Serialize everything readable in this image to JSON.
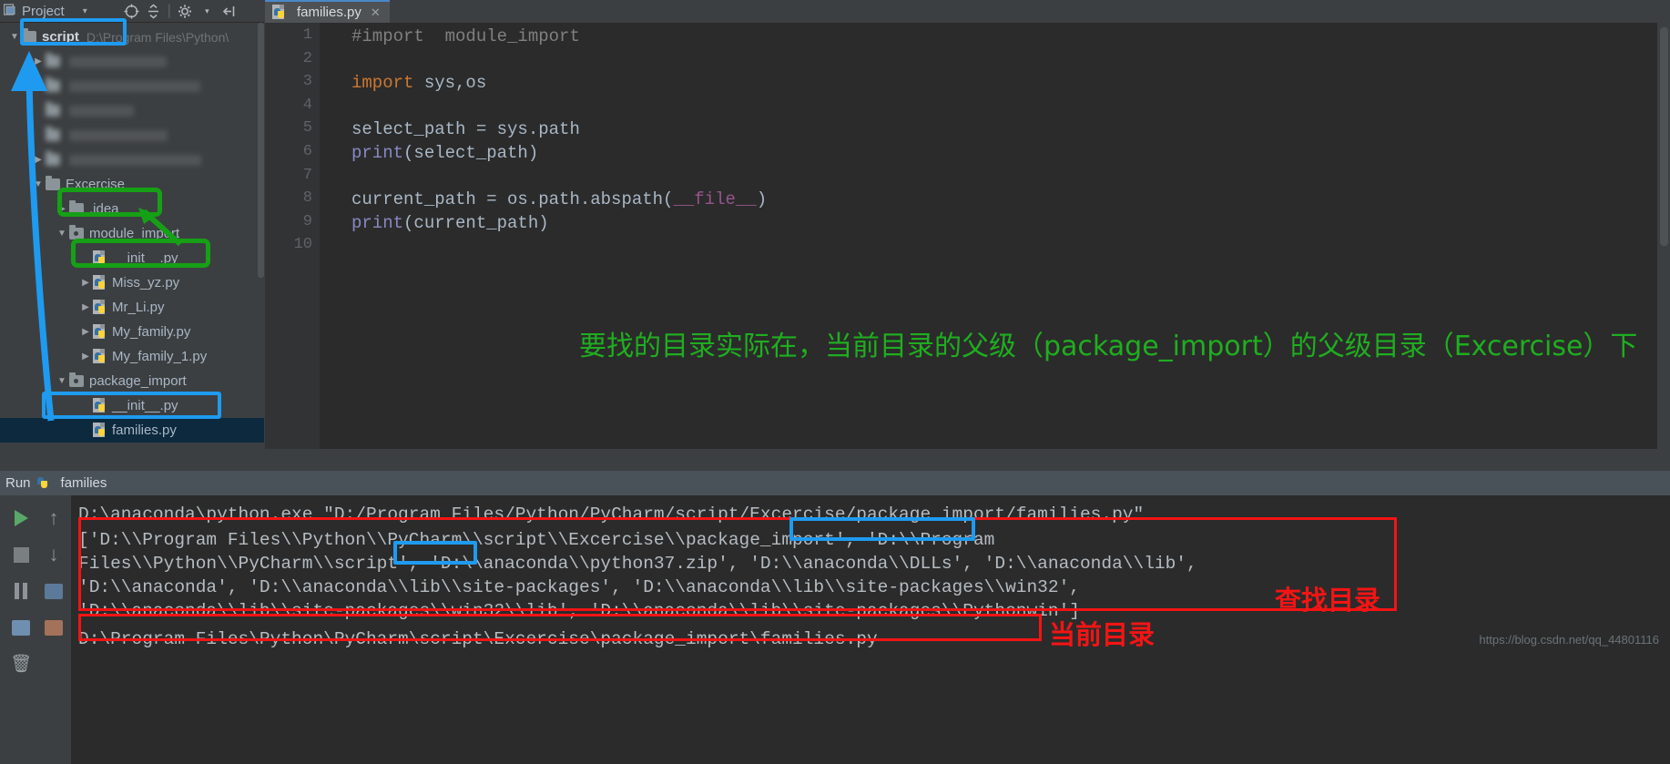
{
  "project": {
    "header": {
      "title": "Project",
      "icon": "project-icon",
      "chevron": "▾",
      "tools": [
        "target-icon",
        "collapse-all-icon",
        "settings-icon",
        "hide-icon"
      ]
    },
    "tree": [
      {
        "id": "script",
        "label": "script",
        "path": "D:\\Program Files\\Python\\",
        "indent": 0,
        "arrow": "▼",
        "type": "folder",
        "bold": true
      },
      {
        "id": "blur1",
        "label": "",
        "indent": 1,
        "arrow": "▶",
        "type": "blur"
      },
      {
        "id": "blur2",
        "label": "",
        "indent": 1,
        "arrow": "▶",
        "type": "blur"
      },
      {
        "id": "blur3",
        "label": "",
        "indent": 1,
        "arrow": "",
        "type": "blur"
      },
      {
        "id": "blur4",
        "label": "",
        "indent": 1,
        "arrow": "",
        "type": "blur"
      },
      {
        "id": "blur5",
        "label": "",
        "indent": 1,
        "arrow": "▶",
        "type": "blur"
      },
      {
        "id": "excercise",
        "label": "Excercise",
        "indent": 1,
        "arrow": "▼",
        "type": "folder"
      },
      {
        "id": "idea",
        "label": ".idea",
        "indent": 2,
        "arrow": "▶",
        "type": "folder"
      },
      {
        "id": "module_import",
        "label": "module_import",
        "indent": 2,
        "arrow": "▼",
        "type": "source-folder"
      },
      {
        "id": "init1",
        "label": "__init__.py",
        "indent": 3,
        "arrow": "",
        "type": "py"
      },
      {
        "id": "miss_yz",
        "label": "Miss_yz.py",
        "indent": 3,
        "arrow": "▶",
        "type": "py"
      },
      {
        "id": "mr_li",
        "label": "Mr_Li.py",
        "indent": 3,
        "arrow": "▶",
        "type": "py"
      },
      {
        "id": "my_family",
        "label": "My_family.py",
        "indent": 3,
        "arrow": "▶",
        "type": "py"
      },
      {
        "id": "my_family_1",
        "label": "My_family_1.py",
        "indent": 3,
        "arrow": "▶",
        "type": "py"
      },
      {
        "id": "package_import",
        "label": "package_import",
        "indent": 2,
        "arrow": "▼",
        "type": "source-folder"
      },
      {
        "id": "init2",
        "label": "__init__.py",
        "indent": 3,
        "arrow": "",
        "type": "py"
      },
      {
        "id": "families",
        "label": "families.py",
        "indent": 3,
        "arrow": "",
        "type": "py",
        "selected": true
      }
    ]
  },
  "editor": {
    "tab": {
      "label": "families.py",
      "icon": "python-file-icon",
      "close": "✕"
    },
    "line_numbers": [
      "1",
      "2",
      "3",
      "4",
      "5",
      "6",
      "7",
      "8",
      "9",
      "10"
    ],
    "code": [
      {
        "n": 1,
        "tokens": [
          {
            "t": "#import  module_import",
            "c": "c-comment"
          }
        ]
      },
      {
        "n": 2,
        "tokens": []
      },
      {
        "n": 3,
        "tokens": [
          {
            "t": "import",
            "c": "c-kw"
          },
          {
            "t": " sys,os",
            "c": "c-plain"
          }
        ]
      },
      {
        "n": 4,
        "tokens": []
      },
      {
        "n": 5,
        "tokens": [
          {
            "t": "select_path = sys.path",
            "c": "c-plain"
          }
        ]
      },
      {
        "n": 6,
        "tokens": [
          {
            "t": "print",
            "c": "c-fn"
          },
          {
            "t": "(select_path)",
            "c": "c-plain"
          }
        ]
      },
      {
        "n": 7,
        "tokens": []
      },
      {
        "n": 8,
        "tokens": [
          {
            "t": "current_path = os.path.abspath(",
            "c": "c-plain"
          },
          {
            "t": "__file__",
            "c": "c-magic"
          },
          {
            "t": ")",
            "c": "c-plain"
          }
        ]
      },
      {
        "n": 9,
        "tokens": [
          {
            "t": "print",
            "c": "c-fn"
          },
          {
            "t": "(current_path)",
            "c": "c-plain"
          }
        ]
      },
      {
        "n": 10,
        "tokens": []
      }
    ],
    "annotation_green": "要找的目录实际在，当前目录的父级（package_import）的父级目录（Excercise）下"
  },
  "run": {
    "header": {
      "label": "Run",
      "icon": "python-run-icon",
      "config": "families"
    },
    "toolbar": [
      "run-icon",
      "up-arrow-icon",
      "stop-icon",
      "down-arrow-icon",
      "pause-icon",
      "rerun-icon",
      "print-icon",
      "export-icon",
      "trash-icon"
    ],
    "console_lines": [
      "D:\\anaconda\\python.exe \"D:/Program Files/Python/PyCharm/script/Excercise/package_import/families.py\"",
      "['D:\\\\Program Files\\\\Python\\\\PyCharm\\\\script\\\\Excercise\\\\package_import', 'D:\\\\Program",
      "Files\\\\Python\\\\PyCharm\\\\script', 'D:\\\\anaconda\\\\python37.zip', 'D:\\\\anaconda\\\\DLLs', 'D:\\\\anaconda\\\\lib',",
      "'D:\\\\anaconda', 'D:\\\\anaconda\\\\lib\\\\site-packages', 'D:\\\\anaconda\\\\lib\\\\site-packages\\\\win32',",
      "'D:\\\\anaconda\\\\lib\\\\site-packages\\\\win32\\\\lib', 'D:\\\\anaconda\\\\lib\\\\site-packages\\\\Pythonwin']",
      "D:\\Program Files\\Python\\PyCharm\\script\\Excercise\\package_import\\families.py"
    ],
    "watermark": "https://blog.csdn.net/qq_44801116"
  },
  "annotations": {
    "label_search_dirs": "查找目录",
    "label_current_dir": "当前目录",
    "colors": {
      "blue": "#1e9bf0",
      "green": "#16a016",
      "red": "#f41414"
    }
  }
}
